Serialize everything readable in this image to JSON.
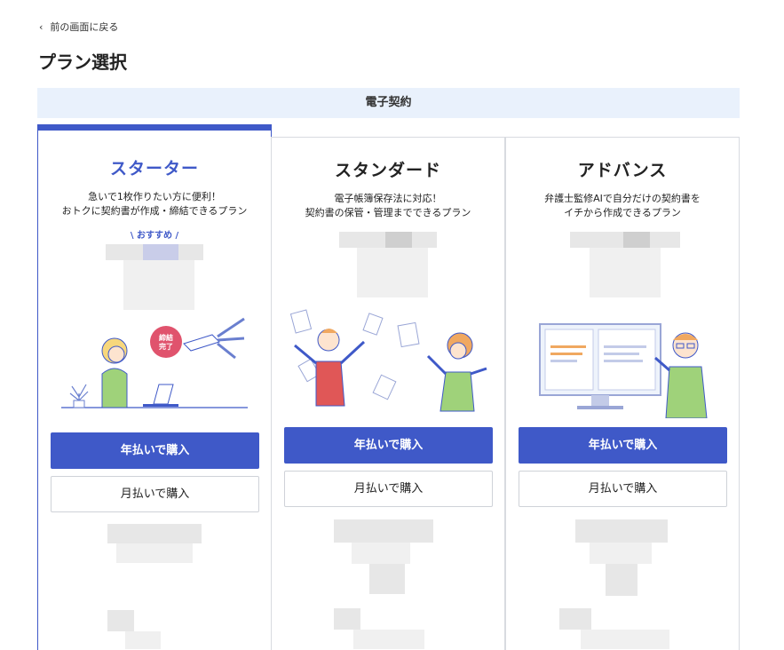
{
  "nav": {
    "back_label": "前の画面に戻る"
  },
  "page": {
    "title": "プラン選択"
  },
  "category": {
    "label": "電子契約"
  },
  "plans": [
    {
      "name": "スターター",
      "desc_line1": "急いで1枚作りたい方に便利！",
      "desc_line2": "おトクに契約書が作成・締結できるプラン",
      "recommended_label": "\\ おすすめ /",
      "illustration_badge": "締結完了",
      "annual_button": "年払いで購入",
      "monthly_button": "月払いで購入"
    },
    {
      "name": "スタンダード",
      "desc_line1": "電子帳簿保存法に対応！",
      "desc_line2": "契約書の保管・管理までできるプラン",
      "annual_button": "年払いで購入",
      "monthly_button": "月払いで購入"
    },
    {
      "name": "アドバンス",
      "desc_line1": "弁護士監修AIで自分だけの契約書を",
      "desc_line2": "イチから作成できるプラン",
      "annual_button": "年払いで購入",
      "monthly_button": "月払いで購入"
    }
  ],
  "colors": {
    "accent": "#3f59c8",
    "category_bg": "#e9f1fc",
    "card_border": "#d8dbe0"
  },
  "icons": {
    "back": "chevron-left-icon"
  }
}
